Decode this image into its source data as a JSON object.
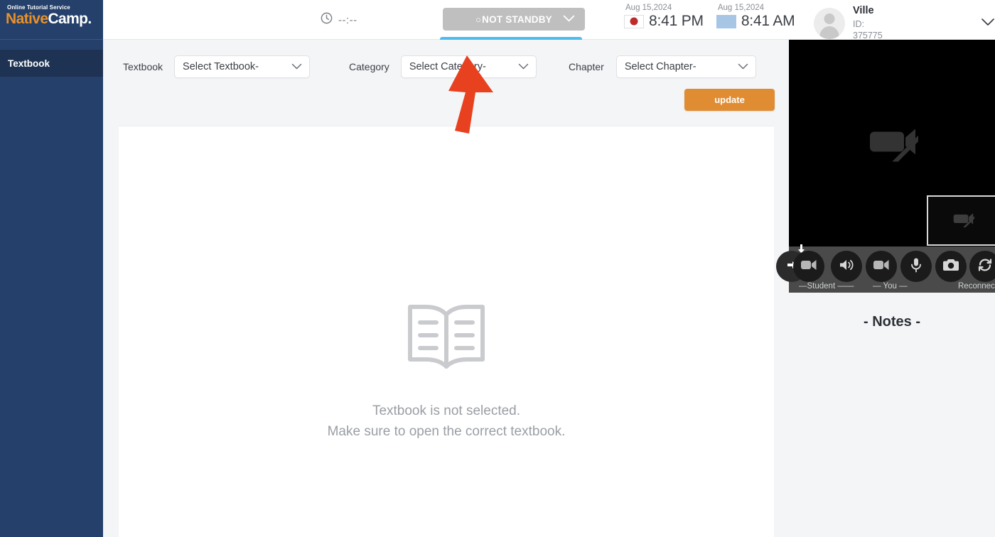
{
  "brand": {
    "tagline": "Online Tutorial Service",
    "name_part1": "Native",
    "name_part2": "Camp."
  },
  "sidebar": {
    "items": [
      {
        "label": "Textbook",
        "active": true
      }
    ]
  },
  "topbar": {
    "timer": {
      "icon": "clock-icon",
      "value": "--:--"
    },
    "standby": {
      "current_label": "NOT STANDBY",
      "radio_glyph": "○",
      "caret_icon": "chevron-down-icon",
      "option_label": "STANDBY",
      "button_color": "#bfbfbf",
      "option_color": "#4cbcf0"
    },
    "clocks": [
      {
        "date": "Aug 15,2024",
        "time": "8:41 PM",
        "flag": "japan-flag",
        "flag_color": "#bc2c2c"
      },
      {
        "date": "Aug 15,2024",
        "time": "8:41 AM",
        "flag": "plain-flag",
        "flag_color": "#a7c6e6"
      }
    ],
    "profile": {
      "avatar_icon": "user-avatar-icon",
      "name": "Ville",
      "id": "ID: 375775",
      "caret_icon": "chevron-down-icon"
    }
  },
  "main": {
    "filters": [
      {
        "label": "Textbook",
        "value": "Select Textbook-"
      },
      {
        "label": "Category",
        "value": "Select Category-"
      },
      {
        "label": "Chapter",
        "value": "Select Chapter-"
      }
    ],
    "update_button": {
      "label": "update",
      "color": "#e08c33"
    },
    "empty_state": {
      "icon": "open-book-icon",
      "line1": "Textbook is not selected.",
      "line2": "Make sure to open the correct textbook."
    }
  },
  "right_panel": {
    "video": {
      "main_icon": "camera-off-icon",
      "pip_icon": "camera-off-icon"
    },
    "controls": [
      {
        "name": "student-camera-toggle",
        "icon": "video-camera-icon"
      },
      {
        "name": "speaker-volume-toggle",
        "icon": "speaker-icon"
      },
      {
        "name": "your-camera-toggle",
        "icon": "video-camera-icon"
      },
      {
        "name": "microphone-toggle",
        "icon": "microphone-icon"
      },
      {
        "name": "snapshot-button",
        "icon": "camera-snapshot-icon"
      },
      {
        "name": "reconnect-button",
        "icon": "refresh-icon"
      }
    ],
    "control_labels": {
      "student": "—Student ——",
      "you": "— You —",
      "reconnect": "Reconnect"
    },
    "notes_title": "- Notes -"
  },
  "annotation": {
    "arrow": {
      "name": "pointer-arrow",
      "color": "#e8411f",
      "points_to": "STANDBY"
    }
  }
}
